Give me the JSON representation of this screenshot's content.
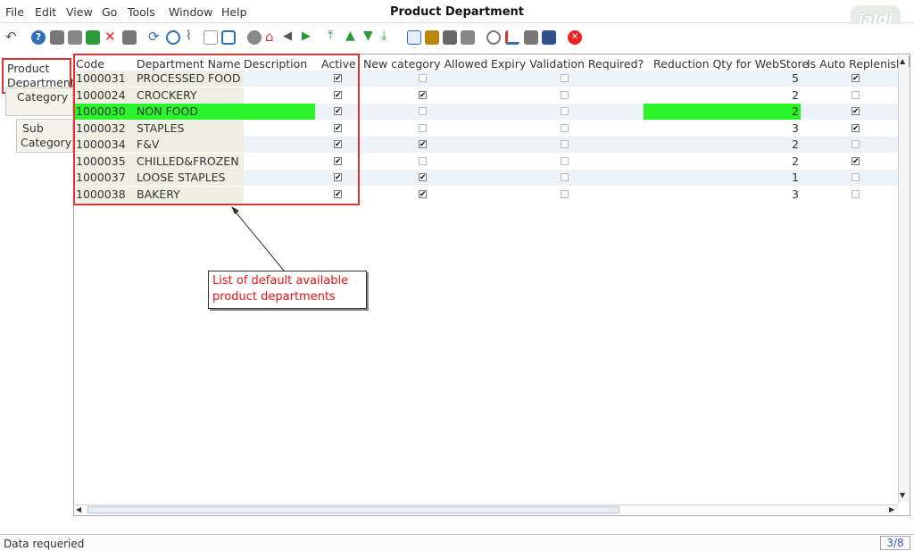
{
  "menu": {
    "file": "File",
    "edit": "Edit",
    "view": "View",
    "go": "Go",
    "tools": "Tools",
    "window": "Window",
    "help": "Help"
  },
  "window_title": "Product Department",
  "logo_text": "jaldi",
  "toolbar": {
    "icons": [
      "undo-icon",
      "help-icon",
      "new-icon",
      "copy-icon",
      "save-icon",
      "delete-icon",
      "print-preview-icon",
      "refresh-icon",
      "find-icon",
      "attachment-icon",
      "chat-icon",
      "fullscreen-icon",
      "archive-icon",
      "home-icon",
      "back-icon",
      "forward-icon",
      "first-record-icon",
      "previous-record-icon",
      "next-record-icon",
      "last-record-icon",
      "report-icon",
      "archive-box-icon",
      "print-icon",
      "print-settings-icon",
      "zoom-icon",
      "workflow-icon",
      "product-icon",
      "history-icon",
      "close-window-icon"
    ]
  },
  "tabs": [
    {
      "label_line1": "Product",
      "label_line2": "Department"
    },
    {
      "label_line1": "Category",
      "label_line2": ""
    },
    {
      "label_line1": "Sub",
      "label_line2": "Category"
    }
  ],
  "table": {
    "headers": {
      "code": "Code",
      "name": "Department Name",
      "description": "Description",
      "active": "Active",
      "new_category": "New category Allowed",
      "expiry": "Expiry Validation Required?",
      "reduction": "Reduction Qty for WebStore",
      "auto_replenish": "Is Auto Replenish"
    },
    "rows": [
      {
        "code": "1000031",
        "name": "PROCESSED FOOD",
        "active": "✔",
        "new_category": "",
        "expiry": "",
        "reduction": "5",
        "auto_replenish": "✔"
      },
      {
        "code": "1000024",
        "name": "CROCKERY",
        "active": "✔",
        "new_category": "✔",
        "expiry": "",
        "reduction": "2",
        "auto_replenish": ""
      },
      {
        "code": "1000030",
        "name": "NON FOOD",
        "active": "✔",
        "new_category": "",
        "expiry": "",
        "reduction": "2",
        "auto_replenish": "✔"
      },
      {
        "code": "1000032",
        "name": "STAPLES",
        "active": "✔",
        "new_category": "",
        "expiry": "",
        "reduction": "3",
        "auto_replenish": "✔"
      },
      {
        "code": "1000034",
        "name": "F&V",
        "active": "✔",
        "new_category": "✔",
        "expiry": "",
        "reduction": "2",
        "auto_replenish": ""
      },
      {
        "code": "1000035",
        "name": "CHILLED&FROZEN",
        "active": "✔",
        "new_category": "",
        "expiry": "",
        "reduction": "2",
        "auto_replenish": "✔"
      },
      {
        "code": "1000037",
        "name": "LOOSE STAPLES",
        "active": "✔",
        "new_category": "✔",
        "expiry": "",
        "reduction": "1",
        "auto_replenish": ""
      },
      {
        "code": "1000038",
        "name": "BAKERY",
        "active": "✔",
        "new_category": "✔",
        "expiry": "",
        "reduction": "3",
        "auto_replenish": ""
      }
    ]
  },
  "callout": {
    "line1": "List of default available",
    "line2": "product departments"
  },
  "status": {
    "message": "Data requeried",
    "page": "3/8"
  },
  "colors": {
    "highlight_green": "#2af52a",
    "annotation_red": "#dd3333",
    "page_indicator": "#3a56c8"
  }
}
